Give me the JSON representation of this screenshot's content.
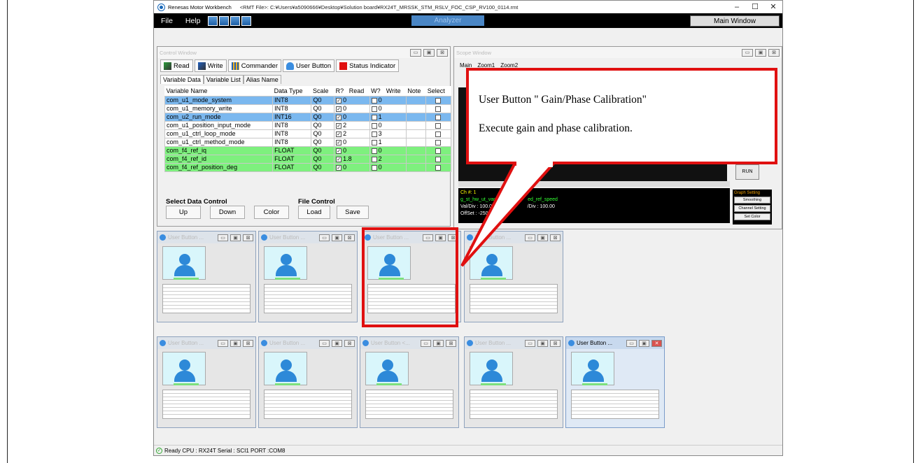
{
  "window": {
    "app_title": "Renesas Motor Workbench",
    "file_path": "<RMT File>: C:¥Users¥a5090666¥Desktop¥Solution board¥RX24T_MRSSK_STM_RSLV_FOC_CSP_RV100_0114.rmt",
    "controls": {
      "minimize": "–",
      "maximize": "☐",
      "close": "✕"
    }
  },
  "menu": {
    "file": "File",
    "help": "Help",
    "analyzer": "Analyzer",
    "main_window": "Main Window"
  },
  "control_window": {
    "title": "Control Window",
    "toolbar": {
      "read": "Read",
      "write": "Write",
      "commander": "Commander",
      "user_button": "User Button",
      "status_indicator": "Status Indicator"
    },
    "tabs": [
      "Variable Data",
      "Variable List",
      "Alias Name"
    ],
    "columns": [
      "Variable Name",
      "Data Type",
      "Scale",
      "R?",
      "Read",
      "W?",
      "Write",
      "Note",
      "Select"
    ],
    "rows": [
      {
        "name": "com_u1_mode_system",
        "type": "INT8",
        "scale": "Q0",
        "read": "0",
        "write": "0",
        "color": "blue"
      },
      {
        "name": "com_u1_memory_write",
        "type": "INT8",
        "scale": "Q0",
        "read": "0",
        "write": "0",
        "color": "white"
      },
      {
        "name": "com_u2_run_mode",
        "type": "INT16",
        "scale": "Q0",
        "read": "0",
        "write": "1",
        "color": "blue"
      },
      {
        "name": "com_u1_position_input_mode",
        "type": "INT8",
        "scale": "Q0",
        "read": "2",
        "write": "0",
        "color": "white"
      },
      {
        "name": "com_u1_ctrl_loop_mode",
        "type": "INT8",
        "scale": "Q0",
        "read": "2",
        "write": "3",
        "color": "white"
      },
      {
        "name": "com_u1_ctrl_method_mode",
        "type": "INT8",
        "scale": "Q0",
        "read": "0",
        "write": "1",
        "color": "white"
      },
      {
        "name": "com_f4_ref_iq",
        "type": "FLOAT",
        "scale": "Q0",
        "read": "0",
        "write": "0",
        "color": "green"
      },
      {
        "name": "com_f4_ref_id",
        "type": "FLOAT",
        "scale": "Q0",
        "read": "1.8",
        "write": "2",
        "color": "green"
      },
      {
        "name": "com_f4_ref_position_deg",
        "type": "FLOAT",
        "scale": "Q0",
        "read": "0",
        "write": "0",
        "color": "green"
      }
    ],
    "select_data_control": "Select Data Control",
    "file_control": "File Control",
    "buttons": {
      "up": "Up",
      "down": "Down",
      "color": "Color",
      "load": "Load",
      "save": "Save"
    }
  },
  "scope_window": {
    "title": "Scope Window",
    "tabs": [
      "Main",
      "Zoom1",
      "Zoom2"
    ],
    "info_lines": [
      "Ch #: 1",
      "g_st_hw_ut_var_f4",
      "Val/Div : 100.00",
      "OffSet : -250",
      "ed_ref_speed",
      "/Div : 100.00"
    ],
    "run": "RUN",
    "graph_setting": "Graph Setting",
    "graph_buttons": [
      "Smoothing",
      "Channel Setting",
      "Set Color"
    ]
  },
  "user_buttons": [
    {
      "title": "User Button ...",
      "active": false
    },
    {
      "title": "User Button ...",
      "active": false
    },
    {
      "title": "User Button ...",
      "active": false
    },
    {
      "title": "User Button ...",
      "active": false
    },
    {
      "title": "User Button ...",
      "active": false
    },
    {
      "title": "User Button ...",
      "active": false
    },
    {
      "title": "User Button <...",
      "active": false
    },
    {
      "title": "User Button ...",
      "active": false
    },
    {
      "title": "User Button ...",
      "active": true
    }
  ],
  "status_bar": {
    "text": "Ready  CPU : RX24T Serial : SCI1  PORT :COM8"
  },
  "callout": {
    "line1": "User Button \" Gain/Phase Calibration\"",
    "line2": "Execute gain and phase calibration."
  },
  "colors": {
    "highlight": "#e01010",
    "row_blue": "#7bb8ef",
    "row_green": "#7ef07e"
  }
}
